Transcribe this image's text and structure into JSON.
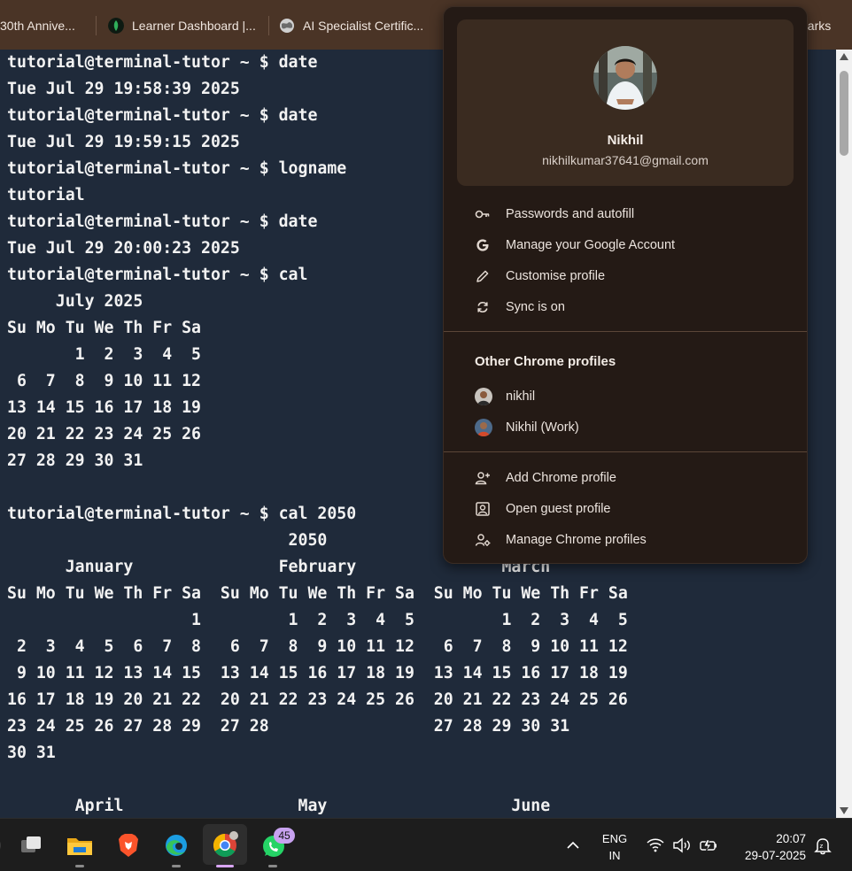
{
  "bookmarks": [
    {
      "label": "30th Annive...",
      "icon": "bookmark-icon"
    },
    {
      "label": "Learner Dashboard |...",
      "icon": "leaf-icon"
    },
    {
      "label": "AI Specialist Certific...",
      "icon": "globe-icon"
    },
    {
      "label": "harks",
      "icon": "folder-icon"
    }
  ],
  "terminal": {
    "lines": [
      "tutorial@terminal-tutor ~ $ date",
      "Tue Jul 29 19:58:39 2025",
      "tutorial@terminal-tutor ~ $ date",
      "Tue Jul 29 19:59:15 2025",
      "tutorial@terminal-tutor ~ $ logname",
      "tutorial",
      "tutorial@terminal-tutor ~ $ date",
      "Tue Jul 29 20:00:23 2025",
      "tutorial@terminal-tutor ~ $ cal",
      "     July 2025",
      "Su Mo Tu We Th Fr Sa",
      "       1  2  3  4  5",
      " 6  7  8  9 10 11 12",
      "13 14 15 16 17 18 19",
      "20 21 22 23 24 25 26",
      "27 28 29 30 31",
      "",
      "tutorial@terminal-tutor ~ $ cal 2050",
      "                             2050",
      "      January               February               March",
      "Su Mo Tu We Th Fr Sa  Su Mo Tu We Th Fr Sa  Su Mo Tu We Th Fr Sa",
      "                   1         1  2  3  4  5         1  2  3  4  5",
      " 2  3  4  5  6  7  8   6  7  8  9 10 11 12   6  7  8  9 10 11 12",
      " 9 10 11 12 13 14 15  13 14 15 16 17 18 19  13 14 15 16 17 18 19",
      "16 17 18 19 20 21 22  20 21 22 23 24 25 26  20 21 22 23 24 25 26",
      "23 24 25 26 27 28 29  27 28                 27 28 29 30 31",
      "30 31",
      "",
      "       April                  May                   June"
    ]
  },
  "profile_menu": {
    "name": "Nikhil",
    "email": "nikhilkumar37641@gmail.com",
    "items": [
      {
        "label": "Passwords and autofill",
        "icon": "key-icon"
      },
      {
        "label": "Manage your Google Account",
        "icon": "google-g-icon"
      },
      {
        "label": "Customise profile",
        "icon": "pencil-icon"
      },
      {
        "label": "Sync is on",
        "icon": "sync-icon"
      }
    ],
    "other_heading": "Other Chrome profiles",
    "other_profiles": [
      {
        "label": "nikhil",
        "icon": "profile-avatar-icon"
      },
      {
        "label": "Nikhil (Work)",
        "icon": "profile-avatar-icon"
      }
    ],
    "actions": [
      {
        "label": "Add Chrome profile",
        "icon": "add-person-icon"
      },
      {
        "label": "Open guest profile",
        "icon": "guest-profile-icon"
      },
      {
        "label": "Manage Chrome profiles",
        "icon": "manage-profiles-icon"
      }
    ]
  },
  "taskbar": {
    "apps": [
      {
        "name": "task-view-icon"
      },
      {
        "name": "file-explorer-icon"
      },
      {
        "name": "brave-browser-icon"
      },
      {
        "name": "edge-browser-icon"
      },
      {
        "name": "chrome-browser-icon"
      },
      {
        "name": "whatsapp-icon"
      }
    ],
    "whatsapp_badge": "45",
    "language_line1": "ENG",
    "language_line2": "IN",
    "time": "20:07",
    "date": "29-07-2025"
  }
}
